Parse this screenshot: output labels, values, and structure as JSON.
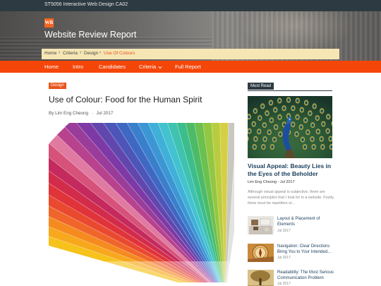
{
  "topbar": {
    "text": "ST5056 Interactive Web Design CA02"
  },
  "header": {
    "logo_text": "WR",
    "site_title": "Website Review Report"
  },
  "breadcrumb": {
    "items": [
      "Home",
      "Criteria",
      "Design",
      "Use Of Colours"
    ]
  },
  "nav": {
    "items": [
      "Home",
      "Intro",
      "Candidates",
      "Criteria",
      "Full Report"
    ],
    "dropdown_icon": "chevron-down-icon"
  },
  "post": {
    "category": "Design",
    "title": "Use of Colour: Food for the Human Spirit",
    "author": "By Lim Eng Cheong",
    "separator": "-",
    "date": "Jul 2017",
    "image": "colour-swatch-fan"
  },
  "sidebar": {
    "widget_title": "Must Read",
    "featured": {
      "image": "peacock",
      "title": "Visual Appeal: Beauty Lies in the Eyes of the Beholder",
      "meta": "Lim Eng Cheong - Jul 2017",
      "excerpt": "Although visual appeal is subjective, there are several principles that I look for in a website. Firstly, there must be repetition or..."
    },
    "items": [
      {
        "title": "Layout & Placement of Elements",
        "date": "Jul 2017",
        "image": "desk-layout"
      },
      {
        "title": "Navigation: Clear Directions Bring You to Your Intended...",
        "date": "Jul 2017",
        "image": "compass"
      },
      {
        "title": "Readability: The Most Serious Communication Problem",
        "date": "Jul 2017",
        "image": "tree"
      }
    ]
  },
  "colors": {
    "nav": "#f5460a",
    "topbar": "#2d3a42",
    "accent": "#e8541a",
    "breadcrumb_bg": "#f6e6b4",
    "link": "#1a3e5c"
  }
}
